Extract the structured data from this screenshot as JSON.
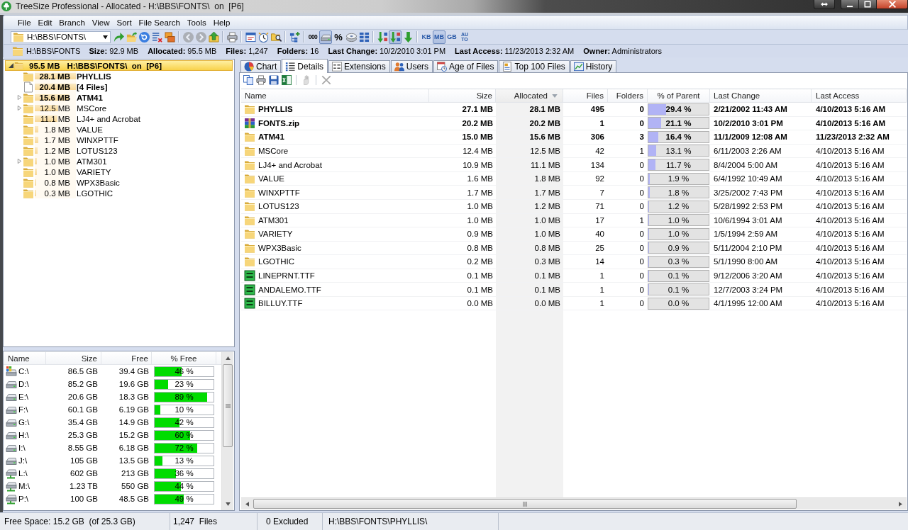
{
  "window": {
    "title": "TreeSize Professional - Allocated - H:\\BBS\\FONTS\\  on  [P6]"
  },
  "menu": [
    "File",
    "Edit",
    "Branch",
    "View",
    "Sort",
    "File Search",
    "Tools",
    "Help"
  ],
  "toolbar": {
    "path": "H:\\BBS\\FONTS\\",
    "groups": [
      {
        "buttons": [
          {
            "kind": "icon",
            "pressed": false,
            "disabled": false
          },
          {
            "kind": "icon",
            "pressed": false,
            "disabled": false
          },
          {
            "kind": "icon",
            "pressed": false,
            "disabled": false
          },
          {
            "kind": "icon",
            "pressed": false,
            "disabled": false
          },
          {
            "kind": "icon",
            "pressed": false,
            "disabled": false
          }
        ]
      },
      {
        "buttons": [
          {
            "kind": "icon",
            "pressed": false,
            "disabled": true
          },
          {
            "kind": "icon",
            "pressed": false,
            "disabled": true
          },
          {
            "kind": "icon",
            "pressed": false,
            "disabled": false
          }
        ]
      },
      {
        "buttons": [
          {
            "kind": "icon",
            "pressed": false,
            "disabled": false
          }
        ]
      },
      {
        "buttons": [
          {
            "kind": "icon",
            "pressed": false,
            "disabled": false
          },
          {
            "kind": "icon",
            "pressed": false,
            "disabled": false
          },
          {
            "kind": "icon",
            "pressed": false,
            "disabled": false
          }
        ]
      },
      {
        "buttons": [
          {
            "kind": "icon",
            "pressed": false,
            "disabled": false
          }
        ]
      },
      {
        "buttons": [
          {
            "kind": "text",
            "label": "000",
            "pressed": false,
            "disabled": false
          },
          {
            "kind": "icon",
            "pressed": true,
            "disabled": false
          },
          {
            "kind": "text",
            "label": "%",
            "pressed": false,
            "disabled": false
          },
          {
            "kind": "icon",
            "pressed": false,
            "disabled": false
          },
          {
            "kind": "icon",
            "pressed": false,
            "disabled": false
          }
        ]
      },
      {
        "buttons": [
          {
            "kind": "icon",
            "pressed": false,
            "disabled": false
          },
          {
            "kind": "icon",
            "pressed": true,
            "disabled": false
          },
          {
            "kind": "icon",
            "pressed": false,
            "disabled": false
          }
        ]
      },
      {
        "buttons": [
          {
            "kind": "text",
            "label": "KB",
            "pressed": false,
            "disabled": false
          },
          {
            "kind": "text",
            "label": "MB",
            "pressed": true,
            "disabled": false
          },
          {
            "kind": "text",
            "label": "GB",
            "pressed": false,
            "disabled": false
          },
          {
            "kind": "text",
            "label": "AU TO",
            "pressed": false,
            "disabled": false
          }
        ]
      }
    ]
  },
  "info_bar": {
    "path": "H:\\BBS\\FONTS",
    "fields": [
      {
        "label": "Size:",
        "value": "92.9 MB"
      },
      {
        "label": "Allocated:",
        "value": "95.5 MB"
      },
      {
        "label": "Files:",
        "value": "1,247"
      },
      {
        "label": "Folders:",
        "value": "16"
      },
      {
        "label": "Last Change:",
        "value": "10/2/2010 3:01 PM"
      },
      {
        "label": "Last Access:",
        "value": "11/23/2013 2:32 AM"
      },
      {
        "label": "Owner:",
        "value": "Administrators"
      }
    ]
  },
  "tree": {
    "root": {
      "size": "95.5 MB",
      "name": "H:\\BBS\\FONTS\\  on  [P6]",
      "expanded": true,
      "selected": true,
      "emphasized": true,
      "children": [
        {
          "kind": "folder",
          "size": "28.1 MB",
          "name": "PHYLLIS",
          "expandable": false,
          "expanded": false,
          "emphasized": true,
          "level": 1.0,
          "selected": false
        },
        {
          "kind": "files",
          "size": "20.4 MB",
          "name": "[4 Files]",
          "expandable": false,
          "expanded": false,
          "emphasized": true,
          "level": 1.0,
          "selected": false
        },
        {
          "kind": "folder",
          "size": "15.6 MB",
          "name": "ATM41",
          "expandable": true,
          "expanded": false,
          "emphasized": true,
          "level": 0.83,
          "selected": false
        },
        {
          "kind": "folder",
          "size": "12.5 MB",
          "name": "MSCore",
          "expandable": true,
          "expanded": false,
          "emphasized": false,
          "level": 0.57,
          "selected": false
        },
        {
          "kind": "folder",
          "size": "11.1 MB",
          "name": "LJ4+ and Acrobat",
          "expandable": false,
          "expanded": false,
          "emphasized": false,
          "level": 0.55,
          "selected": false
        },
        {
          "kind": "folder",
          "size": "1.8 MB",
          "name": "VALUE",
          "expandable": false,
          "expanded": false,
          "emphasized": false,
          "level": 0.09,
          "selected": false
        },
        {
          "kind": "folder",
          "size": "1.7 MB",
          "name": "WINXPTTF",
          "expandable": false,
          "expanded": false,
          "emphasized": false,
          "level": 0.09,
          "selected": false
        },
        {
          "kind": "folder",
          "size": "1.2 MB",
          "name": "LOTUS123",
          "expandable": false,
          "expanded": false,
          "emphasized": false,
          "level": 0.07,
          "selected": false
        },
        {
          "kind": "folder",
          "size": "1.0 MB",
          "name": "ATM301",
          "expandable": true,
          "expanded": false,
          "emphasized": false,
          "level": 0.05,
          "selected": false
        },
        {
          "kind": "folder",
          "size": "1.0 MB",
          "name": "VARIETY",
          "expandable": false,
          "expanded": false,
          "emphasized": false,
          "level": 0.05,
          "selected": false
        },
        {
          "kind": "folder",
          "size": "0.8 MB",
          "name": "WPX3Basic",
          "expandable": false,
          "expanded": false,
          "emphasized": false,
          "level": 0.04,
          "selected": false
        },
        {
          "kind": "folder",
          "size": "0.3 MB",
          "name": "LGOTHIC",
          "expandable": false,
          "expanded": false,
          "emphasized": false,
          "level": 0.03,
          "selected": false
        }
      ]
    }
  },
  "drives": {
    "columns": [
      "Name",
      "Size",
      "Free",
      "% Free"
    ],
    "rows": [
      {
        "kind": "system",
        "name": "C:\\",
        "size": "86.5 GB",
        "free": "39.4 GB",
        "level": 0.46,
        "percent": "46 %"
      },
      {
        "kind": "local",
        "name": "D:\\",
        "size": "85.2 GB",
        "free": "19.6 GB",
        "level": 0.23,
        "percent": "23 %"
      },
      {
        "kind": "local",
        "name": "E:\\",
        "size": "20.6 GB",
        "free": "18.3 GB",
        "level": 0.89,
        "percent": "89 %"
      },
      {
        "kind": "local",
        "name": "F:\\",
        "size": "60.1 GB",
        "free": "6.19 GB",
        "level": 0.1,
        "percent": "10 %"
      },
      {
        "kind": "local",
        "name": "G:\\",
        "size": "35.4 GB",
        "free": "14.9 GB",
        "level": 0.42,
        "percent": "42 %"
      },
      {
        "kind": "local",
        "name": "H:\\",
        "size": "25.3 GB",
        "free": "15.2 GB",
        "level": 0.6,
        "percent": "60 %"
      },
      {
        "kind": "local",
        "name": "I:\\",
        "size": "8.55 GB",
        "free": "6.18 GB",
        "level": 0.72,
        "percent": "72 %"
      },
      {
        "kind": "local",
        "name": "J:\\",
        "size": "105 GB",
        "free": "13.5 GB",
        "level": 0.13,
        "percent": "13 %"
      },
      {
        "kind": "network",
        "name": "L:\\",
        "size": "602 GB",
        "free": "213 GB",
        "level": 0.36,
        "percent": "36 %"
      },
      {
        "kind": "network",
        "name": "M:\\",
        "size": "1.23 TB",
        "free": "550 GB",
        "level": 0.44,
        "percent": "44 %"
      },
      {
        "kind": "network",
        "name": "P:\\",
        "size": "100 GB",
        "free": "48.5 GB",
        "level": 0.49,
        "percent": "49 %"
      }
    ]
  },
  "tabs": [
    {
      "label": "Chart",
      "selected": false
    },
    {
      "label": "Details",
      "selected": true
    },
    {
      "label": "Extensions",
      "selected": false
    },
    {
      "label": "Users",
      "selected": false
    },
    {
      "label": "Age of Files",
      "selected": false
    },
    {
      "label": "Top 100 Files",
      "selected": false
    },
    {
      "label": "History",
      "selected": false
    }
  ],
  "details_toolbar": [
    {
      "buttons": [
        {
          "disabled": false
        },
        {
          "disabled": false
        },
        {
          "disabled": false
        },
        {
          "disabled": false
        }
      ]
    },
    {
      "buttons": [
        {
          "disabled": true
        }
      ]
    },
    {
      "buttons": [
        {
          "disabled": true
        }
      ]
    }
  ],
  "details": {
    "columns": [
      {
        "label": "Name",
        "sorted": false
      },
      {
        "label": "Size",
        "sorted": false
      },
      {
        "label": "Allocated",
        "sorted": true
      },
      {
        "label": "Files",
        "sorted": false
      },
      {
        "label": "Folders",
        "sorted": false
      },
      {
        "label": "% of Parent",
        "sorted": false
      },
      {
        "label": "Last Change",
        "sorted": false
      },
      {
        "label": "Last Access",
        "sorted": false
      }
    ],
    "rows": [
      {
        "kind": "folder",
        "name": "PHYLLIS",
        "size": "27.1 MB",
        "allocated": "28.1 MB",
        "files": "495",
        "folders": "0",
        "level": 0.294,
        "percent": "29.4 %",
        "last_change": "2/21/2002 11:43 AM",
        "last_access": "4/10/2013 5:16 AM",
        "emphasized": true
      },
      {
        "kind": "archive",
        "name": "FONTS.zip",
        "size": "20.2 MB",
        "allocated": "20.2 MB",
        "files": "1",
        "folders": "0",
        "level": 0.211,
        "percent": "21.1 %",
        "last_change": "10/2/2010 3:01 PM",
        "last_access": "4/10/2013 5:16 AM",
        "emphasized": true
      },
      {
        "kind": "folder",
        "name": "ATM41",
        "size": "15.0 MB",
        "allocated": "15.6 MB",
        "files": "306",
        "folders": "3",
        "level": 0.164,
        "percent": "16.4 %",
        "last_change": "11/1/2009 12:08 AM",
        "last_access": "11/23/2013 2:32 AM",
        "emphasized": true
      },
      {
        "kind": "folder",
        "name": "MSCore",
        "size": "12.4 MB",
        "allocated": "12.5 MB",
        "files": "42",
        "folders": "1",
        "level": 0.131,
        "percent": "13.1 %",
        "last_change": "6/11/2003 2:26 AM",
        "last_access": "4/10/2013 5:16 AM",
        "emphasized": false
      },
      {
        "kind": "folder",
        "name": "LJ4+ and Acrobat",
        "size": "10.9 MB",
        "allocated": "11.1 MB",
        "files": "134",
        "folders": "0",
        "level": 0.117,
        "percent": "11.7 %",
        "last_change": "8/4/2004 5:00 AM",
        "last_access": "4/10/2013 5:16 AM",
        "emphasized": false
      },
      {
        "kind": "folder",
        "name": "VALUE",
        "size": "1.6 MB",
        "allocated": "1.8 MB",
        "files": "92",
        "folders": "0",
        "level": 0.019,
        "percent": "1.9 %",
        "last_change": "6/4/1992 10:49 AM",
        "last_access": "4/10/2013 5:16 AM",
        "emphasized": false
      },
      {
        "kind": "folder",
        "name": "WINXPTTF",
        "size": "1.7 MB",
        "allocated": "1.7 MB",
        "files": "7",
        "folders": "0",
        "level": 0.018,
        "percent": "1.8 %",
        "last_change": "3/25/2002 7:43 PM",
        "last_access": "4/10/2013 5:16 AM",
        "emphasized": false
      },
      {
        "kind": "folder",
        "name": "LOTUS123",
        "size": "1.0 MB",
        "allocated": "1.2 MB",
        "files": "71",
        "folders": "0",
        "level": 0.012,
        "percent": "1.2 %",
        "last_change": "5/28/1992 2:53 PM",
        "last_access": "4/10/2013 5:16 AM",
        "emphasized": false
      },
      {
        "kind": "folder",
        "name": "ATM301",
        "size": "1.0 MB",
        "allocated": "1.0 MB",
        "files": "17",
        "folders": "1",
        "level": 0.012,
        "percent": "1.0 %",
        "last_change": "10/6/1994 3:01 AM",
        "last_access": "4/10/2013 5:16 AM",
        "emphasized": false
      },
      {
        "kind": "folder",
        "name": "VARIETY",
        "size": "0.9 MB",
        "allocated": "1.0 MB",
        "files": "40",
        "folders": "0",
        "level": 0.012,
        "percent": "1.0 %",
        "last_change": "1/5/1994 2:59 AM",
        "last_access": "4/10/2013 5:16 AM",
        "emphasized": false
      },
      {
        "kind": "folder",
        "name": "WPX3Basic",
        "size": "0.8 MB",
        "allocated": "0.8 MB",
        "files": "25",
        "folders": "0",
        "level": 0.012,
        "percent": "0.9 %",
        "last_change": "5/11/2004 2:10 PM",
        "last_access": "4/10/2013 5:16 AM",
        "emphasized": false
      },
      {
        "kind": "folder",
        "name": "LGOTHIC",
        "size": "0.2 MB",
        "allocated": "0.3 MB",
        "files": "14",
        "folders": "0",
        "level": 0.012,
        "percent": "0.3 %",
        "last_change": "5/1/1990 8:00 AM",
        "last_access": "4/10/2013 5:16 AM",
        "emphasized": false
      },
      {
        "kind": "font_file",
        "name": "LINEPRNT.TTF",
        "size": "0.1 MB",
        "allocated": "0.1 MB",
        "files": "1",
        "folders": "0",
        "level": 0.012,
        "percent": "0.1 %",
        "last_change": "9/12/2006 3:20 AM",
        "last_access": "4/10/2013 5:16 AM",
        "emphasized": false
      },
      {
        "kind": "font_file",
        "name": "ANDALEMO.TTF",
        "size": "0.1 MB",
        "allocated": "0.1 MB",
        "files": "1",
        "folders": "0",
        "level": 0.012,
        "percent": "0.1 %",
        "last_change": "12/7/2003 3:24 PM",
        "last_access": "4/10/2013 5:16 AM",
        "emphasized": false
      },
      {
        "kind": "font_file",
        "name": "BILLUY.TTF",
        "size": "0.0 MB",
        "allocated": "0.0 MB",
        "files": "1",
        "folders": "0",
        "percent": "0.0 %",
        "last_change": "4/1/1995 12:00 AM",
        "last_access": "4/10/2013 5:16 AM",
        "emphasized": false
      }
    ]
  },
  "status_bar": [
    "Free Space: 15.2 GB  (of 25.3 GB)",
    "1,247  Files",
    "0 Excluded",
    "H:\\BBS\\FONTS\\PHYLLIS\\"
  ]
}
